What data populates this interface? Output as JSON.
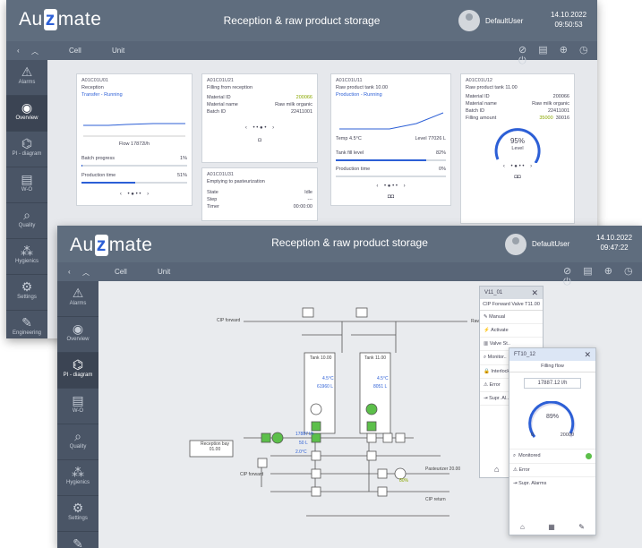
{
  "app": {
    "brand": "Au",
    "brand_z": "z",
    "brand_rest": "mate",
    "title": "Reception & raw product storage"
  },
  "back_window": {
    "user": "DefaultUser",
    "date": "14.10.2022",
    "time": "09:50:53",
    "nav": {
      "cell": "Cell",
      "unit": "Unit"
    },
    "cards": [
      {
        "code": "A01C01U01",
        "name": "Reception",
        "state": "Transfer - Running",
        "flow": "Flow 17872l/h",
        "batch_label": "Batch progress",
        "batch_val": "1%",
        "prod_label": "Production time",
        "prod_val": "51%"
      },
      {
        "code": "A01C01U21",
        "name": "Filling from reception",
        "material_label": "Material ID",
        "material_val": "200066",
        "mat_name_label": "Material name",
        "mat_name_val": "Raw milk organic",
        "batch_label": "Batch ID",
        "batch_val": "22411001"
      },
      {
        "code": "A01C01U31",
        "name": "Emptying to pasteurization",
        "state_label": "State",
        "state_val": "Idle",
        "step_label": "Step",
        "step_val": "---",
        "timer_label": "Timer",
        "timer_val": "00:00:00"
      },
      {
        "code": "A01C01U11",
        "name": "Raw product tank 10.00",
        "state": "Production - Running",
        "temp": "Temp 4.5°C",
        "level": "Level 77026 L",
        "fill_label": "Tank fill level",
        "fill_val": "82%",
        "prod_label": "Production time",
        "prod_val": "0%"
      },
      {
        "code": "A01C01U12",
        "name": "Raw product tank 11.00",
        "material_label": "Material ID",
        "material_val": "200066",
        "mat_name_label": "Material name",
        "mat_name_val": "Raw milk organic",
        "batch_label": "Batch ID",
        "batch_val": "22411001",
        "filling_label": "Filling amount",
        "filling_val": "35000",
        "filling_max": "30016",
        "gauge_val": "95%",
        "gauge_label": "Level"
      }
    ]
  },
  "front_window": {
    "user": "DefaultUser",
    "date": "14.10.2022",
    "time": "09:47:22",
    "nav": {
      "cell": "Cell",
      "unit": "Unit"
    },
    "diagram": {
      "cip_forward": "CIP forward",
      "raw_storage": "Raw product storage",
      "tank_a": "Tank 10.00",
      "tank_b": "Tank 11.00",
      "tank_a_temp": "4.5°C",
      "tank_a_level": "61960 L",
      "tank_b_temp": "4.5°C",
      "tank_b_level": "8051 L",
      "flow": "17887 l/h",
      "flow2": "50 L",
      "temp2": "2.0°C",
      "reception_bay": "Reception bay",
      "reception_bay_code": "01.00",
      "cip_forward2": "CIP forward",
      "pasteurizer": "Pasteurizer 20.00",
      "rpm": "80%",
      "cip_return": "CIP return"
    },
    "valve_panel": {
      "title": "V11_01",
      "subtitle": "CIP Forward Valve T11.00",
      "rows": [
        "Manual",
        "Activate",
        "Valve St..",
        "Monitor..",
        "Interlock",
        "Error",
        "Supr. Al.."
      ]
    },
    "fill_panel": {
      "title": "FT10_12",
      "subtitle": "Filling flow",
      "value": "17887.12 l/h",
      "gauge_val": "89%",
      "min": "0",
      "max": "20000",
      "rows": [
        "Monitored",
        "Error",
        "Supr. Alarms"
      ]
    },
    "sidebar": [
      "Alarms",
      "Overview",
      "PI - diagram",
      "W-O",
      "Quality",
      "Hygienics",
      "Settings",
      "Engineering"
    ]
  },
  "colors": {
    "titlebar": "#5f6d7e",
    "navbar": "#586577",
    "sidebar": "#4a5566",
    "accent": "#2c5fd6",
    "ok": "#5cbf4a"
  }
}
